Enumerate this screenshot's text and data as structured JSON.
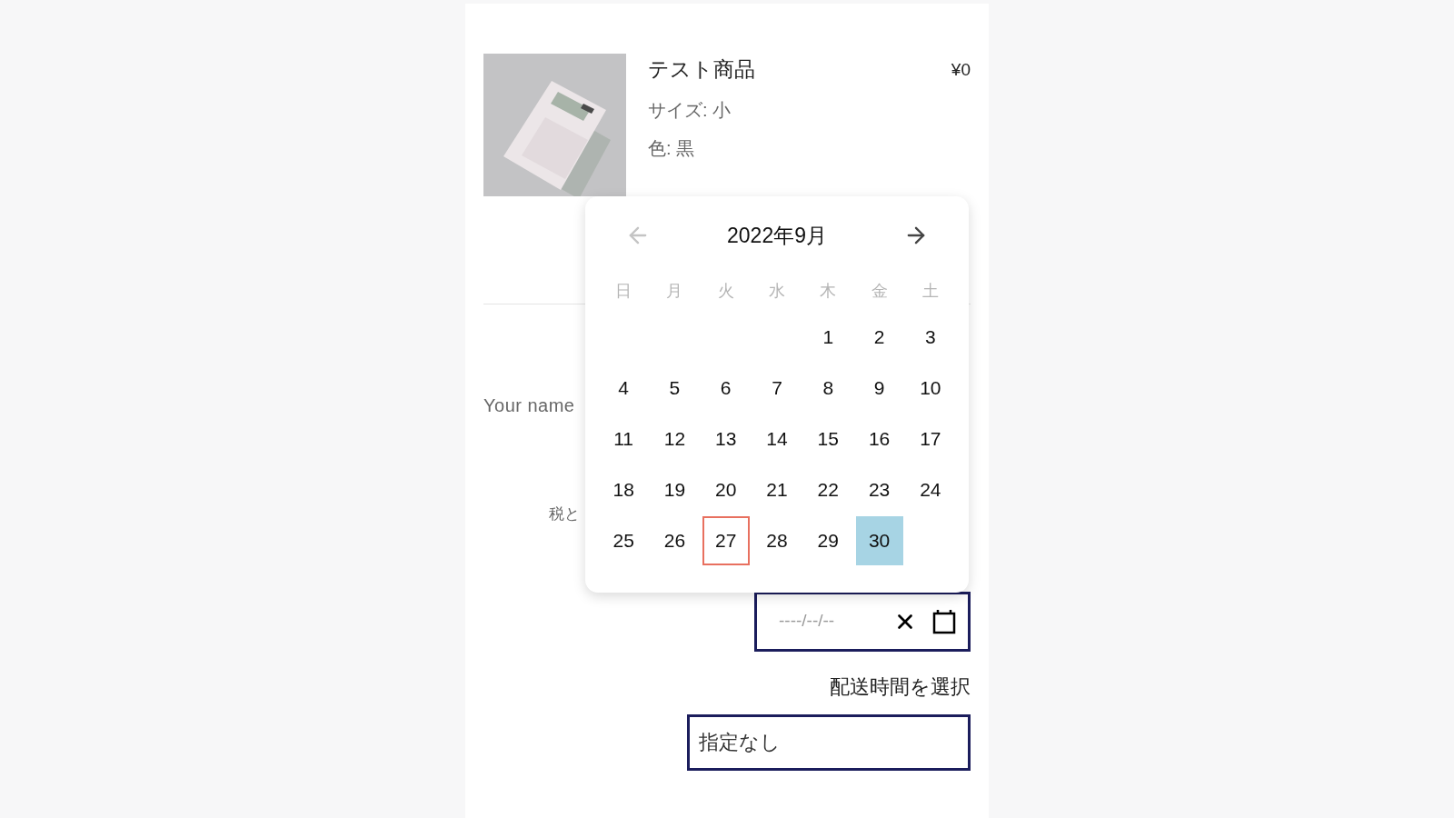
{
  "product": {
    "kind": "picture",
    "name": "テスト商品",
    "price": "¥0",
    "options": [
      "サイズ: 小",
      "色: 黒"
    ]
  },
  "form": {
    "name_label": "Your name",
    "tax_label": "税と"
  },
  "calendar": {
    "title": "2022年9月",
    "prev_disabled": true,
    "next_disabled": false,
    "weekdays": [
      "日",
      "月",
      "火",
      "水",
      "木",
      "金",
      "土"
    ],
    "weeks": [
      {
        "days": [
          {
            "label": "1",
            "selected": false,
            "today": false
          },
          {
            "label": "2",
            "selected": false,
            "today": false
          },
          {
            "label": "3",
            "selected": false,
            "today": false
          }
        ]
      },
      {
        "days": [
          {
            "label": "4",
            "selected": false,
            "today": false
          },
          {
            "label": "5",
            "selected": false,
            "today": false
          },
          {
            "label": "6",
            "selected": false,
            "today": false
          },
          {
            "label": "7",
            "selected": false,
            "today": false
          },
          {
            "label": "8",
            "selected": false,
            "today": false
          },
          {
            "label": "9",
            "selected": false,
            "today": false
          },
          {
            "label": "10",
            "selected": false,
            "today": false
          }
        ]
      },
      {
        "days": [
          {
            "label": "11",
            "selected": false,
            "today": false
          },
          {
            "label": "12",
            "selected": false,
            "today": false
          },
          {
            "label": "13",
            "selected": false,
            "today": false
          },
          {
            "label": "14",
            "selected": false,
            "today": false
          },
          {
            "label": "15",
            "selected": false,
            "today": false
          },
          {
            "label": "16",
            "selected": false,
            "today": false
          },
          {
            "label": "17",
            "selected": false,
            "today": false
          }
        ]
      },
      {
        "days": [
          {
            "label": "18",
            "selected": false,
            "today": false
          },
          {
            "label": "19",
            "selected": false,
            "today": false
          },
          {
            "label": "20",
            "selected": false,
            "today": false
          },
          {
            "label": "21",
            "selected": false,
            "today": false
          },
          {
            "label": "22",
            "selected": false,
            "today": false
          },
          {
            "label": "23",
            "selected": false,
            "today": false
          },
          {
            "label": "24",
            "selected": false,
            "today": false
          }
        ]
      },
      {
        "days": [
          {
            "label": "25",
            "selected": false,
            "today": false
          },
          {
            "label": "26",
            "selected": false,
            "today": false
          },
          {
            "label": "27",
            "selected": false,
            "today": true
          },
          {
            "label": "28",
            "selected": false,
            "today": false
          },
          {
            "label": "29",
            "selected": false,
            "today": false
          },
          {
            "label": "30",
            "selected": true,
            "today": false
          }
        ]
      }
    ]
  },
  "date_field": {
    "placeholder": "----/--/--"
  },
  "time_label": "配送時間を選択",
  "time_select": {
    "value": "指定なし"
  }
}
